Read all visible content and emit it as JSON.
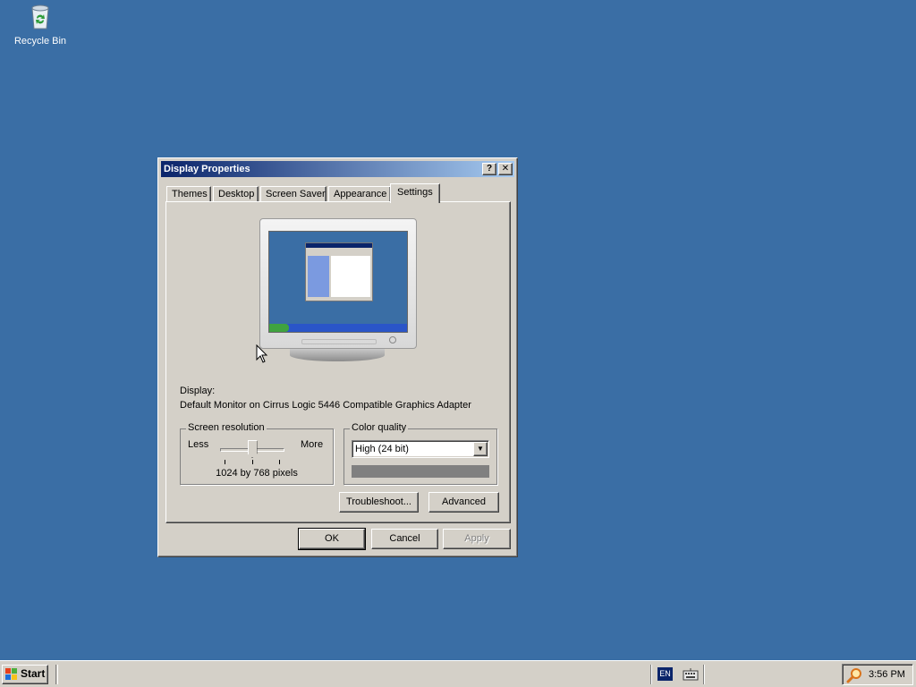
{
  "desktop": {
    "icons": [
      {
        "label": "Recycle Bin",
        "icon": "recycle-bin-icon"
      }
    ]
  },
  "dialog": {
    "title": "Display Properties",
    "help_label": "?",
    "close_label": "✕",
    "tabs": [
      {
        "label": "Themes",
        "active": false
      },
      {
        "label": "Desktop",
        "active": false
      },
      {
        "label": "Screen Saver",
        "active": false
      },
      {
        "label": "Appearance",
        "active": false
      },
      {
        "label": "Settings",
        "active": true
      }
    ],
    "settings": {
      "display_label": "Display:",
      "display_value": "Default Monitor on Cirrus Logic 5446 Compatible Graphics Adapter",
      "screen_resolution": {
        "legend": "Screen resolution",
        "less_label": "Less",
        "more_label": "More",
        "value_text": "1024 by 768 pixels",
        "slider_position": 0.5
      },
      "color_quality": {
        "legend": "Color quality",
        "selected": "High (24 bit)"
      },
      "troubleshoot_label": "Troubleshoot...",
      "advanced_label": "Advanced"
    },
    "buttons": {
      "ok": "OK",
      "cancel": "Cancel",
      "apply": "Apply",
      "apply_enabled": false
    }
  },
  "taskbar": {
    "start_label": "Start",
    "language": "EN",
    "clock": "3:56 PM"
  },
  "colors": {
    "desktop_bg": "#3a6ea5",
    "titlebar_start": "#0a246a",
    "titlebar_end": "#a6caf0",
    "face": "#d4d0c8"
  }
}
